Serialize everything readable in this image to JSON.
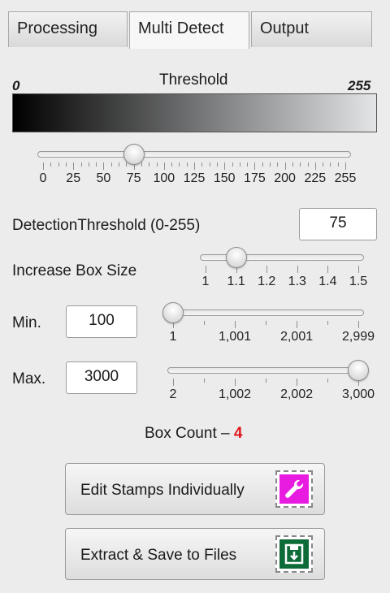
{
  "tabs": [
    {
      "label": "Processing"
    },
    {
      "label": "Multi Detect",
      "active": true
    },
    {
      "label": "Output"
    }
  ],
  "threshold_gradient": {
    "title": "Threshold",
    "min_label": "0",
    "max_label": "255"
  },
  "threshold_slider": {
    "value": 75,
    "min": 0,
    "max": 255,
    "tick_labels": [
      "0",
      "25",
      "50",
      "75",
      "100",
      "125",
      "150",
      "175",
      "200",
      "225",
      "255"
    ]
  },
  "detection_threshold": {
    "label": "DetectionThreshold (0-255)",
    "value": "75"
  },
  "box_size": {
    "label": "Increase Box Size",
    "value": 1.1,
    "min": 1,
    "max": 1.5,
    "tick_labels": [
      "1",
      "1.1",
      "1.2",
      "1.3",
      "1.4",
      "1.5"
    ]
  },
  "min": {
    "label": "Min.",
    "value": "100",
    "slider_value": 1,
    "slider_min": 1,
    "slider_max": 2999,
    "tick_labels": [
      "1",
      "1,001",
      "2,001",
      "2,999"
    ]
  },
  "max": {
    "label": "Max.",
    "value": "3000",
    "slider_value": 3000,
    "slider_min": 2,
    "slider_max": 3000,
    "tick_labels": [
      "2",
      "1,002",
      "2,002",
      "3,000"
    ]
  },
  "box_count": {
    "label": "Box Count –",
    "value": "4",
    "value_color": "#e0161b"
  },
  "buttons": {
    "edit_stamps": {
      "label": "Edit Stamps Individually",
      "icon": "wrench-icon",
      "icon_color": "#e81ce0"
    },
    "extract_save": {
      "label": "Extract & Save to Files",
      "icon": "save-icon",
      "icon_color": "#0d6b38"
    }
  }
}
